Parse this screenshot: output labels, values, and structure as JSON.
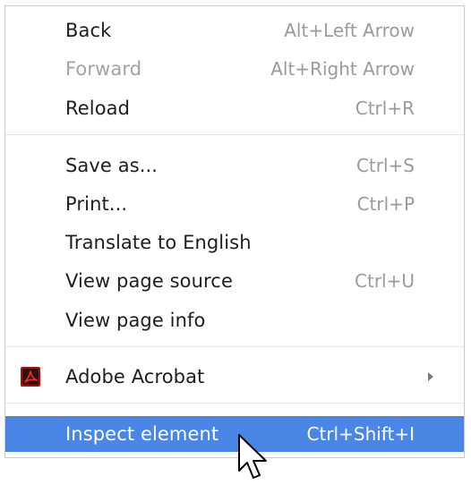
{
  "menu": {
    "groups": [
      [
        {
          "label": "Back",
          "shortcut": "Alt+Left Arrow",
          "enabled": true
        },
        {
          "label": "Forward",
          "shortcut": "Alt+Right Arrow",
          "enabled": false
        },
        {
          "label": "Reload",
          "shortcut": "Ctrl+R",
          "enabled": true
        }
      ],
      [
        {
          "label": "Save as...",
          "shortcut": "Ctrl+S",
          "enabled": true
        },
        {
          "label": "Print...",
          "shortcut": "Ctrl+P",
          "enabled": true
        },
        {
          "label": "Translate to English",
          "shortcut": "",
          "enabled": true
        },
        {
          "label": "View page source",
          "shortcut": "Ctrl+U",
          "enabled": true
        },
        {
          "label": "View page info",
          "shortcut": "",
          "enabled": true
        }
      ],
      [
        {
          "label": "Adobe Acrobat",
          "shortcut": "",
          "enabled": true,
          "icon": "adobe-acrobat-icon",
          "submenu": true
        }
      ],
      [
        {
          "label": "Inspect element",
          "shortcut": "Ctrl+Shift+I",
          "enabled": true,
          "highlighted": true
        }
      ]
    ]
  },
  "colors": {
    "highlight": "#4a86e6",
    "text": "#1e1e1e",
    "disabled_text": "#a3a3a3",
    "shortcut_text": "#9b9b9b",
    "acrobat_red": "#b30b00"
  },
  "cursor": {
    "icon": "mouse-pointer-icon"
  }
}
